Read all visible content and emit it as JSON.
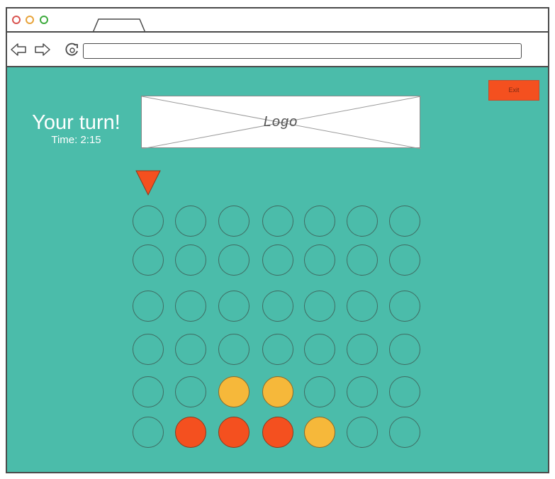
{
  "browser": {
    "window_controls": [
      {
        "name": "close",
        "color": "#d9534f"
      },
      {
        "name": "minimize",
        "color": "#e8a33a"
      },
      {
        "name": "maximize",
        "color": "#3caa3c"
      }
    ],
    "url": ""
  },
  "header": {
    "turn_text": "Your turn!",
    "timer_text": "Time: 2:15",
    "logo_text": "Logo",
    "exit_label": "Exit"
  },
  "colors": {
    "background": "#4bbcaa",
    "red": "#f4501f",
    "yellow": "#f6b83a"
  },
  "game": {
    "columns": 7,
    "rows": 6,
    "pointer_column": 0,
    "board": [
      [
        "empty",
        "empty",
        "empty",
        "empty",
        "empty",
        "empty",
        "empty"
      ],
      [
        "empty",
        "empty",
        "empty",
        "empty",
        "empty",
        "empty",
        "empty"
      ],
      [
        "empty",
        "empty",
        "empty",
        "empty",
        "empty",
        "empty",
        "empty"
      ],
      [
        "empty",
        "empty",
        "empty",
        "empty",
        "empty",
        "empty",
        "empty"
      ],
      [
        "empty",
        "empty",
        "yellow",
        "yellow",
        "empty",
        "empty",
        "empty"
      ],
      [
        "empty",
        "red",
        "red",
        "red",
        "yellow",
        "empty",
        "empty"
      ]
    ]
  }
}
